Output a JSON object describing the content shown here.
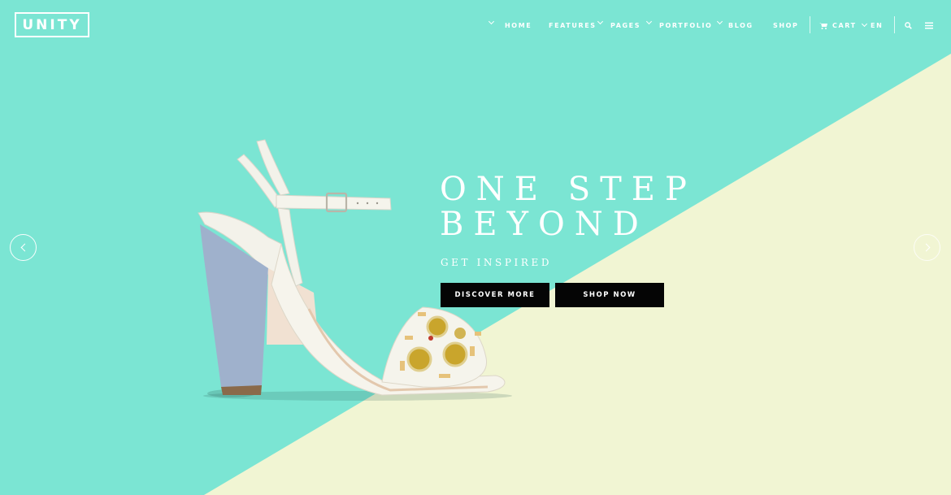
{
  "brand": {
    "logo_text": "UNITY"
  },
  "nav": {
    "items": [
      {
        "label": "HOME",
        "has_dropdown": true
      },
      {
        "label": "FEATURES",
        "has_dropdown": true
      },
      {
        "label": "PAGES",
        "has_dropdown": true
      },
      {
        "label": "PORTFOLIO",
        "has_dropdown": true
      },
      {
        "label": "BLOG",
        "has_dropdown": false
      },
      {
        "label": "SHOP",
        "has_dropdown": false
      }
    ],
    "cart_label": "CART",
    "language_label": "EN",
    "icons": {
      "cart": "cart-icon",
      "search": "search-icon",
      "menu": "menu-icon",
      "dropdown": "chevron-down-icon"
    }
  },
  "slide": {
    "headline_line1": "ONE STEP",
    "headline_line2": "BEYOND",
    "subheadline": "GET INSPIRED",
    "primary_button": "DISCOVER MORE",
    "secondary_button": "SHOP NOW",
    "prev_icon": "chevron-left-icon",
    "next_icon": "chevron-right-icon"
  },
  "colors": {
    "mint": "#7be5d3",
    "cream": "#f1f5d3",
    "button_bg": "#050505",
    "text": "#ffffff"
  }
}
